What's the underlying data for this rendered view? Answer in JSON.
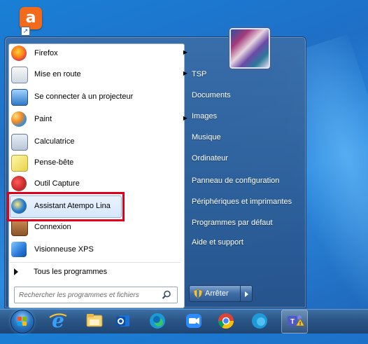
{
  "desktop": {
    "shortcut_icon": "avast-icon",
    "shortcut_letter": "a"
  },
  "start_menu": {
    "user_avatar": "user-avatar-picture",
    "programs": [
      {
        "label": "Firefox",
        "icon": "firefox-icon",
        "has_submenu": true
      },
      {
        "label": "Mise en route",
        "icon": "getting-started-icon",
        "has_submenu": true
      },
      {
        "label": "Se connecter à un projecteur",
        "icon": "projector-icon",
        "has_submenu": false
      },
      {
        "label": "Paint",
        "icon": "paint-icon",
        "has_submenu": true
      },
      {
        "label": "Calculatrice",
        "icon": "calculator-icon",
        "has_submenu": false
      },
      {
        "label": "Pense-bête",
        "icon": "sticky-notes-icon",
        "has_submenu": false
      },
      {
        "label": "Outil Capture",
        "icon": "snipping-tool-icon",
        "has_submenu": false
      },
      {
        "label": "Assistant Atempo Lina",
        "icon": "atempo-lina-icon",
        "has_submenu": false,
        "highlighted": true
      },
      {
        "label": "Connexion",
        "icon": "connexion-icon",
        "has_submenu": false
      },
      {
        "label": "Visionneuse XPS",
        "icon": "xps-viewer-icon",
        "has_submenu": false
      }
    ],
    "all_programs_label": "Tous les programmes",
    "search_placeholder": "Rechercher les programmes et fichiers",
    "right_items": [
      "TSP",
      "Documents",
      "Images",
      "Musique",
      "Ordinateur",
      "Panneau de configuration",
      "Périphériques et imprimantes",
      "Programmes par défaut",
      "Aide et support"
    ],
    "shutdown_label": "Arrêter"
  },
  "taskbar": {
    "items": [
      "start-orb",
      "internet-explorer-icon",
      "file-explorer-icon",
      "outlook-icon",
      "edge-icon",
      "zoom-icon",
      "chrome-icon",
      "edge-beta-icon",
      "teams-icon"
    ]
  },
  "colors": {
    "highlight_border": "#e0001b",
    "menu_blue": "#3a6ea8",
    "taskbar": "#2a5585"
  }
}
